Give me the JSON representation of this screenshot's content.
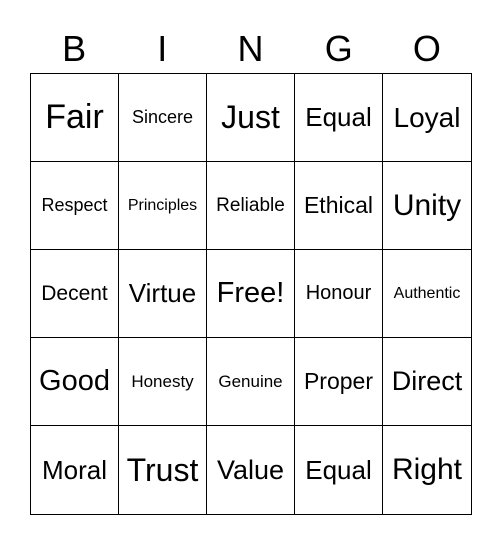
{
  "header": [
    "B",
    "I",
    "N",
    "G",
    "O"
  ],
  "cells": [
    [
      "Fair",
      "Sincere",
      "Just",
      "Equal",
      "Loyal"
    ],
    [
      "Respect",
      "Principles",
      "Reliable",
      "Ethical",
      "Unity"
    ],
    [
      "Decent",
      "Virtue",
      "Free!",
      "Honour",
      "Authentic"
    ],
    [
      "Good",
      "Honesty",
      "Genuine",
      "Proper",
      "Direct"
    ],
    [
      "Moral",
      "Trust",
      "Value",
      "Equal",
      "Right"
    ]
  ]
}
